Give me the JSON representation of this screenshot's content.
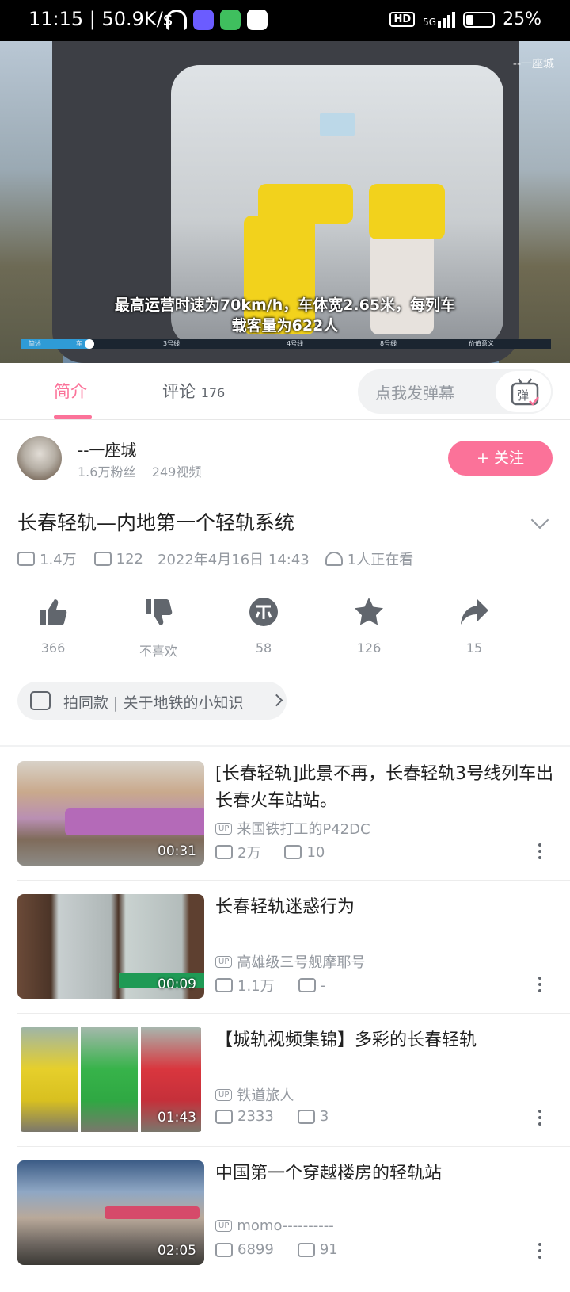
{
  "status_bar": {
    "time": "11:15",
    "network_speed": "50.9K/s",
    "hd": "HD",
    "signal": "5G",
    "battery": "25%"
  },
  "video": {
    "subtitle_line1": "最高运营时速为70km/h，车体宽2.65米，每列车",
    "subtitle_line2": "载客量为622人",
    "watermark": "--一座城",
    "chapters": [
      "简述",
      "车",
      "3号线",
      "4号线",
      "8号线",
      "价值意义"
    ],
    "progress": 0.13
  },
  "tabs": {
    "intro": "简介",
    "comments": "评论",
    "comments_count": "176",
    "danmaku_placeholder": "点我发弹幕"
  },
  "author": {
    "name": "--一座城",
    "fans": "1.6万粉丝",
    "videos": "249视频",
    "follow_label": "+ 关注"
  },
  "main_video": {
    "title": "长春轻轨—内地第一个轻轨系统",
    "views": "1.4万",
    "danmaku": "122",
    "date": "2022年4月16日 14:43",
    "watching": "1人正在看"
  },
  "actions": [
    {
      "name": "like",
      "label": "366"
    },
    {
      "name": "dislike",
      "label": "不喜欢"
    },
    {
      "name": "coin",
      "label": "58"
    },
    {
      "name": "favorite",
      "label": "126"
    },
    {
      "name": "share",
      "label": "15"
    }
  ],
  "template_pill": "拍同款 | 关于地铁的小知识",
  "recommendations": [
    {
      "title": "[长春轻轨]此景不再，长春轻轨3号线列车出长春火车站站。",
      "up": "来国铁打工的P42DC",
      "views": "2万",
      "danmaku": "10",
      "duration": "00:31"
    },
    {
      "title": "长春轻轨迷惑行为",
      "up": "高雄级三号舰摩耶号",
      "views": "1.1万",
      "danmaku": "-",
      "duration": "00:09"
    },
    {
      "title": "【城轨视频集锦】多彩的长春轻轨",
      "up": "铁道旅人",
      "views": "2333",
      "danmaku": "3",
      "duration": "01:43"
    },
    {
      "title": "中国第一个穿越楼房的轻轨站",
      "up": "momo----------",
      "views": "6899",
      "danmaku": "91",
      "duration": "02:05"
    }
  ],
  "colors": {
    "accent": "#fb7299",
    "text_secondary": "#9499a0"
  }
}
